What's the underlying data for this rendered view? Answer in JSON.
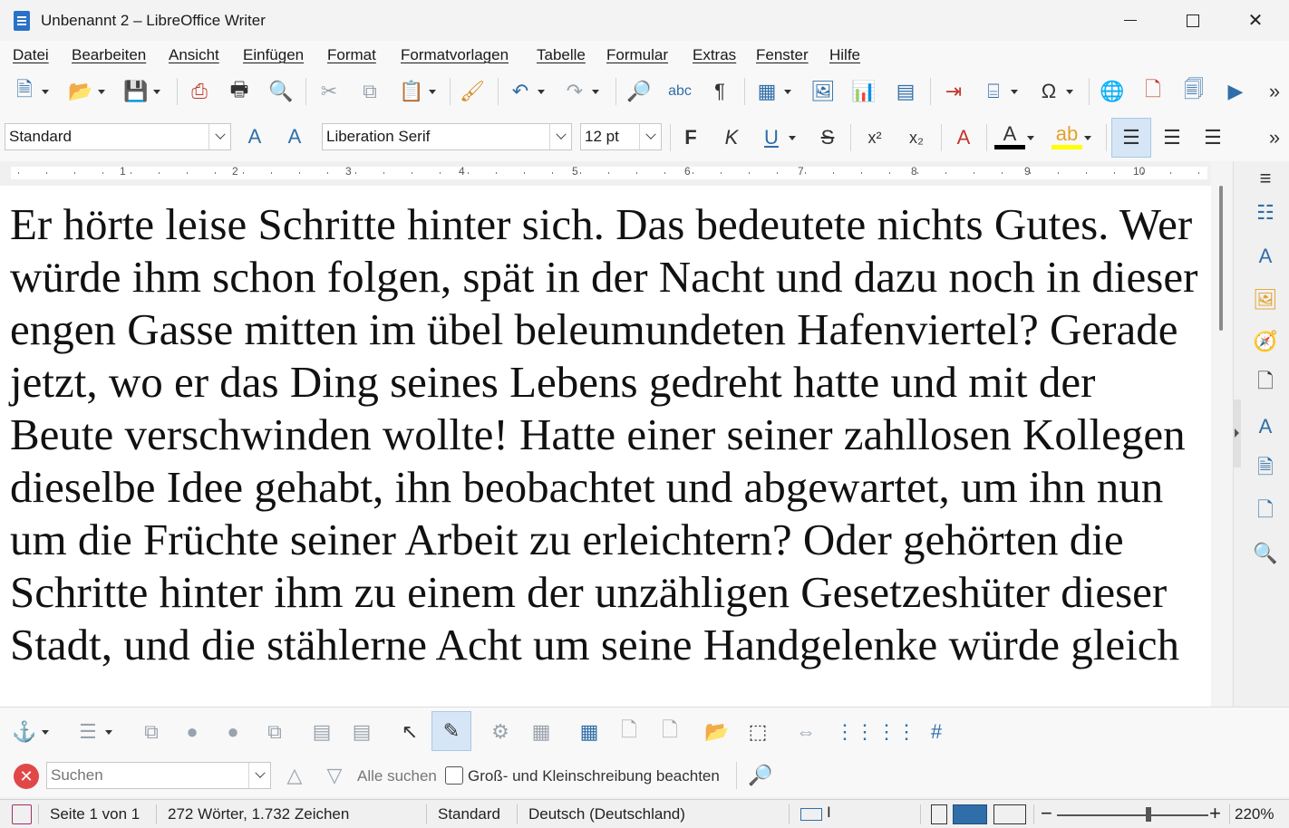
{
  "window": {
    "title": "Unbenannt 2 – LibreOffice Writer",
    "close_glyph": "✕"
  },
  "menu": [
    "Datei",
    "Bearbeiten",
    "Ansicht",
    "Einfügen",
    "Format",
    "Formatvorlagen",
    "Tabelle",
    "Formular",
    "Extras",
    "Fenster",
    "Hilfe"
  ],
  "formatting": {
    "paragraph_style": "Standard",
    "font_name": "Liberation Serif",
    "font_size": "12 pt",
    "bold_glyph": "F",
    "italic_glyph": "K",
    "underline_glyph": "U",
    "strike_glyph": "S"
  },
  "ruler": {
    "numbers": [
      "1",
      "2",
      "3",
      "4",
      "5",
      "6",
      "7",
      "8",
      "9",
      "10"
    ]
  },
  "document": {
    "text": "Er hörte leise Schritte hinter sich. Das bedeutete nichts Gutes. Wer würde ihm schon folgen, spät in der Nacht und dazu noch in dieser engen Gasse mitten im übel beleumundeten Hafenviertel? Gerade jetzt, wo er das Ding seines Lebens gedreht hatte und mit der Beute verschwinden wollte! Hatte einer seiner zahllosen Kollegen dieselbe Idee gehabt, ihn beobachtet und abgewartet, um ihn nun um die Früchte seiner Arbeit zu erleichtern? Oder gehörten die Schritte hinter ihm zu einem der unzähligen Gesetzeshüter dieser Stadt, und die stählerne Acht um seine Handgelenke würde gleich"
  },
  "find": {
    "placeholder": "Suchen",
    "find_all": "Alle suchen",
    "match_case": "Groß- und Kleinschreibung beachten"
  },
  "status": {
    "page": "Seite 1 von 1",
    "words": "272 Wörter, 1.732 Zeichen",
    "page_style": "Standard",
    "language": "Deutsch (Deutschland)",
    "zoom": "220%",
    "zoom_out": "−",
    "zoom_in": "+"
  },
  "colors": {
    "accent": "#2f6ea8",
    "font_color": "#000000",
    "highlight": "#ffff00",
    "close_red": "#e04848"
  }
}
